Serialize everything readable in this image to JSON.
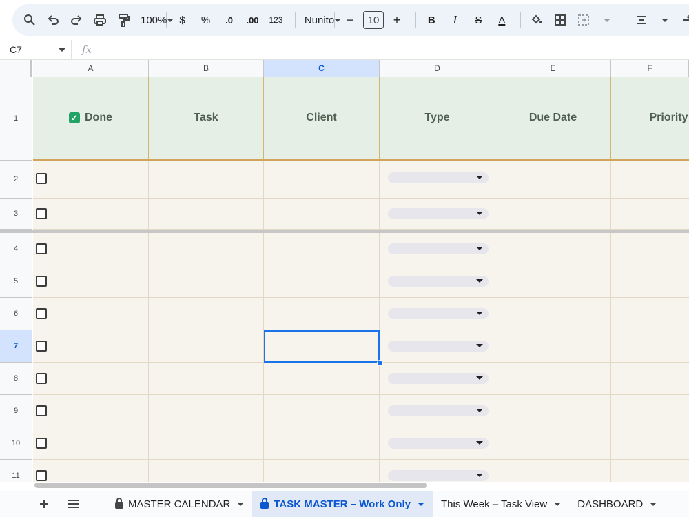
{
  "toolbar": {
    "zoom": "100%",
    "currency": "$",
    "percent": "%",
    "decrease_decimals": ".0",
    "increase_decimals": ".00",
    "more_formats": "123",
    "font": "Nunito",
    "font_size": "10",
    "minus": "−",
    "plus": "+",
    "bold": "B",
    "italic": "I",
    "strike": "S",
    "text_color": "A"
  },
  "formula_bar": {
    "cell_ref": "C7",
    "fx": "fx"
  },
  "columns": [
    "A",
    "B",
    "C",
    "D",
    "E",
    "F"
  ],
  "selected_column": "C",
  "rows": [
    "1",
    "2",
    "3",
    "4",
    "5",
    "6",
    "7",
    "8",
    "9",
    "10",
    "11"
  ],
  "selected_row": "7",
  "headers": {
    "done": "Done",
    "task": "Task",
    "client": "Client",
    "type": "Type",
    "due_date": "Due Date",
    "priority": "Priority"
  },
  "tabs": [
    {
      "label": "MASTER CALENDAR",
      "locked": true,
      "active": false
    },
    {
      "label": "TASK MASTER – Work Only",
      "locked": true,
      "active": true
    },
    {
      "label": "This Week – Task View",
      "locked": false,
      "active": false
    },
    {
      "label": "DASHBOARD",
      "locked": false,
      "active": false
    }
  ],
  "colors": {
    "header_fill": "#e5efe6",
    "body_fill": "#f7f4ee",
    "header_border": "#d1a35b",
    "selection": "#1a73e8"
  }
}
